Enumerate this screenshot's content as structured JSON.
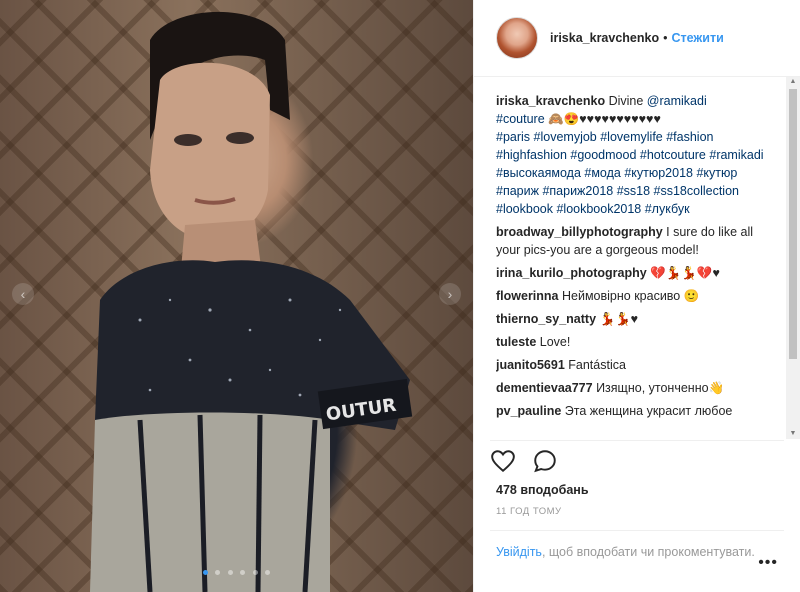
{
  "post": {
    "author": "iriska_kravchenko",
    "separator": "•",
    "follow_label": "Стежити",
    "caption": {
      "user": "iriska_kravchenko",
      "text_before": " Divine ",
      "mention": "@ramikadi",
      "line1_tag": "#couture",
      "line1_rest": " 🙈😍♥♥♥♥♥♥♥♥♥♥♥",
      "tags_text": "#paris #lovemyjob #lovemylife #fashion #highfashion #goodmood #hotcouture #ramikadi #высокаямода #мода #кутюр2018 #кутюр #париж #париж2018 #ss18 #ss18collection #lookbook #lookbook2018 #лукбук"
    },
    "comments": [
      {
        "user": "broadway_billyphotography",
        "text": " I sure do like all your pics-you are a gorgeous model!"
      },
      {
        "user": "irina_kurilo_photography",
        "text": " 💔💃💃💔♥"
      },
      {
        "user": "flowerinna",
        "text": " Неймовірно красиво 🙂"
      },
      {
        "user": "thierno_sy_natty",
        "text": " 💃💃♥"
      },
      {
        "user": "tuleste",
        "text": " Love!"
      },
      {
        "user": "juanito5691",
        "text": " Fantástica"
      },
      {
        "user": "dementievaa777",
        "text": " Изящно, утонченно👋"
      },
      {
        "user": "pv_pauline",
        "text": " Эта женщина украсит любое"
      }
    ],
    "likes": "478 вподобань",
    "time_ago": "11 ГОД ТОМУ",
    "login_link": "Увійдіть",
    "login_text": ", щоб вподобати чи прокоментувати.",
    "more_label": "•••"
  },
  "media": {
    "prev_arrow": "‹",
    "next_arrow": "›",
    "sleeve_text": "OUTUR"
  },
  "scrollbar": {
    "up": "▲",
    "down": "▼"
  },
  "colors": {
    "link": "#3897f0",
    "hashtag": "#003569",
    "muted": "#999999"
  },
  "icons": [
    "heart-icon",
    "comment-icon",
    "chevron-left-icon",
    "chevron-right-icon",
    "more-options-icon"
  ]
}
